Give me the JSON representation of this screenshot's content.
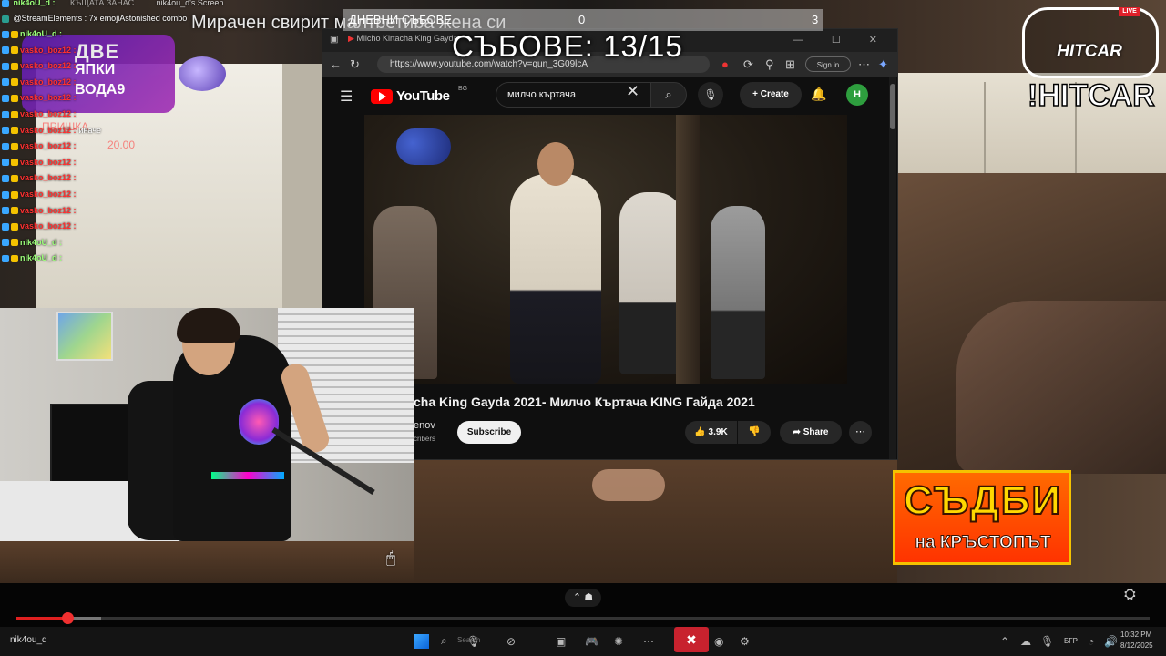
{
  "headline": "Мирачен свирит малтретира жена си",
  "stats": {
    "label": "ДНЕВНИ СЪБОВЕ",
    "mid": "0",
    "right": "3",
    "counter": "СЪБОВЕ: 13/15"
  },
  "browser": {
    "tab_title": "Milcho Kirtacha King Gayda",
    "url": "https://www.youtube.com/watch?v=qun_3G09lcA",
    "signin": "Sign in",
    "window_controls": "—  ☐  ✕"
  },
  "youtube": {
    "logo": "YouTube",
    "region": "BG",
    "search_query": "милчо къртача",
    "create_label": "Create",
    "avatar_letter": "H",
    "video_title": "cha King Gayda 2021- Милчо Къртача KING Гайда 2021",
    "channel": "enov",
    "subscribers": "cribers",
    "subscribe_label": "Subscribe",
    "likes": "3.9K",
    "share_label": "Share"
  },
  "chat": {
    "header": "nik4oU_d :",
    "header_extra": "КЪЩАТА ЗАНАС",
    "screen_label": "nik4ou_d's Screen",
    "streamelements": "@StreamElements : 7x emojiAstonished combo",
    "rows": [
      {
        "user": "nik4oU_d :",
        "msg": "",
        "type": "user2"
      },
      {
        "user": "vasko_boz12 :",
        "msg": "",
        "type": "user"
      },
      {
        "user": "vasko_boz12 :",
        "msg": "",
        "type": "user"
      },
      {
        "user": "vasko_boz12 :",
        "msg": "",
        "type": "user"
      },
      {
        "user": "vasko_boz12 :",
        "msg": "",
        "type": "user"
      },
      {
        "user": "vasko_boz12 :",
        "msg": "",
        "type": "user"
      },
      {
        "user": "vasko_boz12 :",
        "msg": "иначе",
        "type": "user"
      },
      {
        "user": "vasko_boz12 :",
        "msg": "",
        "type": "user"
      },
      {
        "user": "vasko_boz12 :",
        "msg": "",
        "type": "user"
      },
      {
        "user": "vasko_boz12 :",
        "msg": "",
        "type": "user"
      },
      {
        "user": "vasko_boz12 :",
        "msg": "",
        "type": "user"
      },
      {
        "user": "vasko_boz12 :",
        "msg": "",
        "type": "user"
      },
      {
        "user": "vasko_boz12 :",
        "msg": "",
        "type": "user"
      },
      {
        "user": "nik4oU_d :",
        "msg": "",
        "type": "user2"
      },
      {
        "user": "nik4oU_d :",
        "msg": "",
        "type": "user2"
      }
    ],
    "logo_text1": "ДВЕ",
    "logo_text2": "ЯПКИ",
    "logo_text3": "ВОДА9",
    "ghost1": "ПРИШКА",
    "ghost2": "20.00"
  },
  "overlays": {
    "hitcar_logo": "HITCAR",
    "hitcar_live": "LIVE",
    "hitcar_command": "!HITCAR",
    "sadbi_title": "СЪДБИ",
    "sadbi_sub": "на КРЪСТОПЪТ"
  },
  "player": {
    "progress": 0.045,
    "buffered": 0.03
  },
  "taskbar": {
    "user": "nik4ou_d",
    "search_placeholder": "Search",
    "lang": "БГР",
    "time": "10:32 PM",
    "date": "8/12/2025"
  },
  "colors": {
    "accent_red": "#e02020",
    "youtube_red": "#ff0000",
    "chat_name": "#ff3030"
  }
}
